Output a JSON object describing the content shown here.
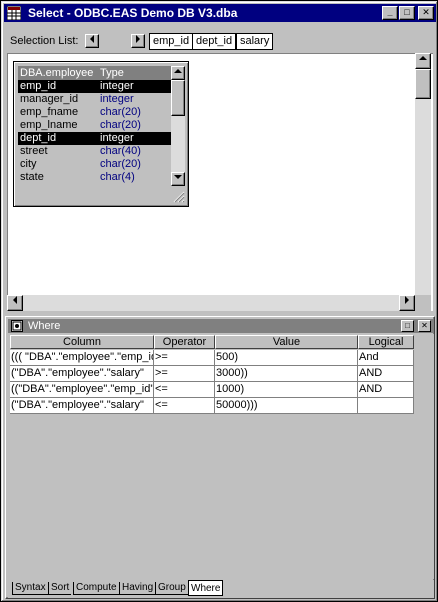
{
  "window": {
    "title": "Select - ODBC.EAS Demo DB V3.dba",
    "minimize": "_",
    "maximize": "□",
    "close": "✕"
  },
  "selection": {
    "label": "Selection List:",
    "items": [
      "emp_id",
      "dept_id",
      "salary"
    ]
  },
  "table": {
    "name": "DBA.employee",
    "type_header": "Type",
    "fields": [
      {
        "name": "emp_id",
        "type": "integer",
        "selected": true
      },
      {
        "name": "manager_id",
        "type": "integer",
        "selected": false
      },
      {
        "name": "emp_fname",
        "type": "char(20)",
        "selected": false
      },
      {
        "name": "emp_lname",
        "type": "char(20)",
        "selected": false
      },
      {
        "name": "dept_id",
        "type": "integer",
        "selected": true
      },
      {
        "name": "street",
        "type": "char(40)",
        "selected": false
      },
      {
        "name": "city",
        "type": "char(20)",
        "selected": false
      },
      {
        "name": "state",
        "type": "char(4)",
        "selected": false
      }
    ]
  },
  "where": {
    "title": "Where",
    "columns": [
      "Column",
      "Operator",
      "Value",
      "Logical"
    ],
    "rows": [
      [
        "((( \"DBA\".\"employee\".\"emp_id\"",
        ">=",
        "500)",
        "And"
      ],
      [
        "(\"DBA\".\"employee\".\"salary\"",
        ">=",
        "3000))",
        "AND"
      ],
      [
        "((\"DBA\".\"employee\".\"emp_id\"",
        "<=",
        "1000)",
        "AND"
      ],
      [
        "(\"DBA\".\"employee\".\"salary\"",
        "<=",
        "50000)))",
        ""
      ]
    ]
  },
  "tabs": [
    "Syntax",
    "Sort",
    "Compute",
    "Having",
    "Group",
    "Where"
  ],
  "active_tab": "Where"
}
